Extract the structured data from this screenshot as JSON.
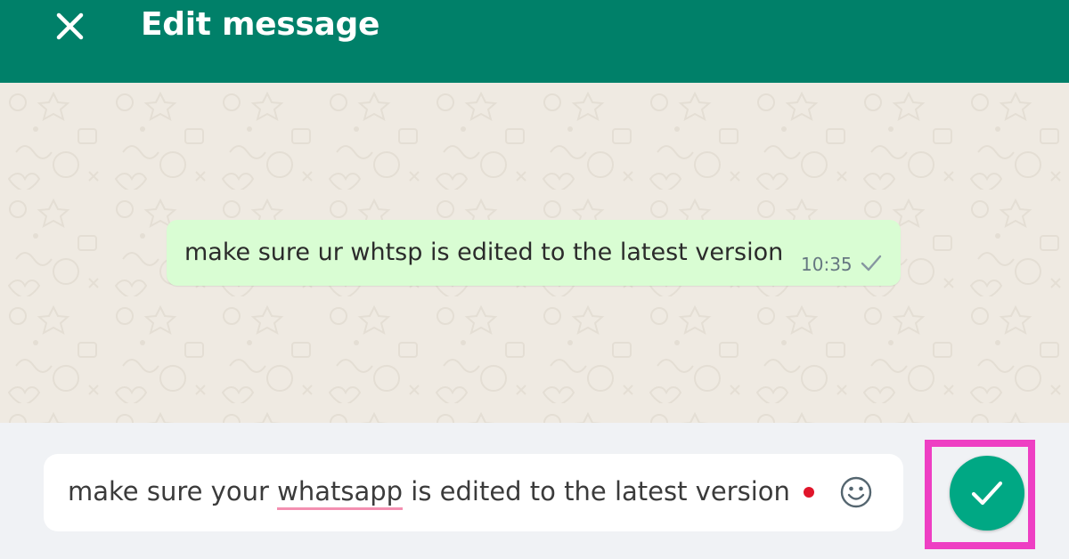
{
  "header": {
    "close_icon": "close-icon",
    "title": "Edit message"
  },
  "message": {
    "text": "make sure ur whtsp is edited to the latest version",
    "time": "10:35",
    "status_icon": "single-check-icon"
  },
  "composer": {
    "text_before": "make sure your ",
    "text_misspelled": "whatsapp",
    "text_after": " is edited to the latest version",
    "emoji_icon": "emoji-icon",
    "send_icon": "check-icon"
  },
  "colors": {
    "header": "#008069",
    "chat_background": "#efeae2",
    "bubble": "#d9fdd3",
    "footer": "#f0f2f5",
    "send_button": "#00a884",
    "highlight": "#ee3fc3"
  }
}
